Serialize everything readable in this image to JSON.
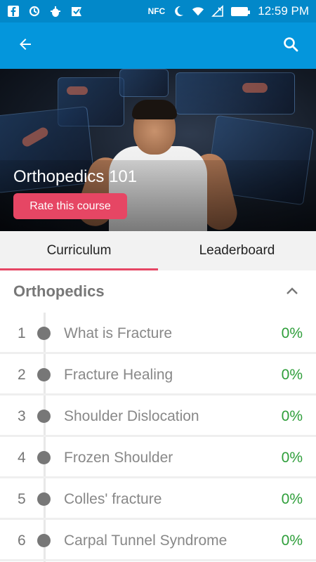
{
  "status_bar": {
    "time": "12:59 PM",
    "nfc_label": "NFC",
    "icons": [
      "facebook-icon",
      "sync-icon",
      "android-debug-icon",
      "checkmark-app-icon",
      "nfc-icon",
      "moon-icon",
      "wifi-icon",
      "no-signal-icon",
      "battery-icon"
    ]
  },
  "app_bar": {
    "back_icon": "arrow-back-icon",
    "search_icon": "search-icon",
    "color": "#0496dc"
  },
  "course": {
    "title": "Orthopedics 101",
    "rate_button_label": "Rate this course",
    "accent_color": "#e64664"
  },
  "tabs": [
    {
      "label": "Curriculum",
      "active": true
    },
    {
      "label": "Leaderboard",
      "active": false
    }
  ],
  "section": {
    "title": "Orthopedics",
    "expanded": true
  },
  "lessons": [
    {
      "number": "1",
      "title": "What is Fracture",
      "progress": "0%"
    },
    {
      "number": "2",
      "title": "Fracture Healing",
      "progress": "0%"
    },
    {
      "number": "3",
      "title": "Shoulder Dislocation",
      "progress": "0%"
    },
    {
      "number": "4",
      "title": "Frozen Shoulder",
      "progress": "0%"
    },
    {
      "number": "5",
      "title": "Colles' fracture",
      "progress": "0%"
    },
    {
      "number": "6",
      "title": "Carpal Tunnel Syndrome",
      "progress": "0%"
    }
  ],
  "progress_color": "#2e9e3a"
}
